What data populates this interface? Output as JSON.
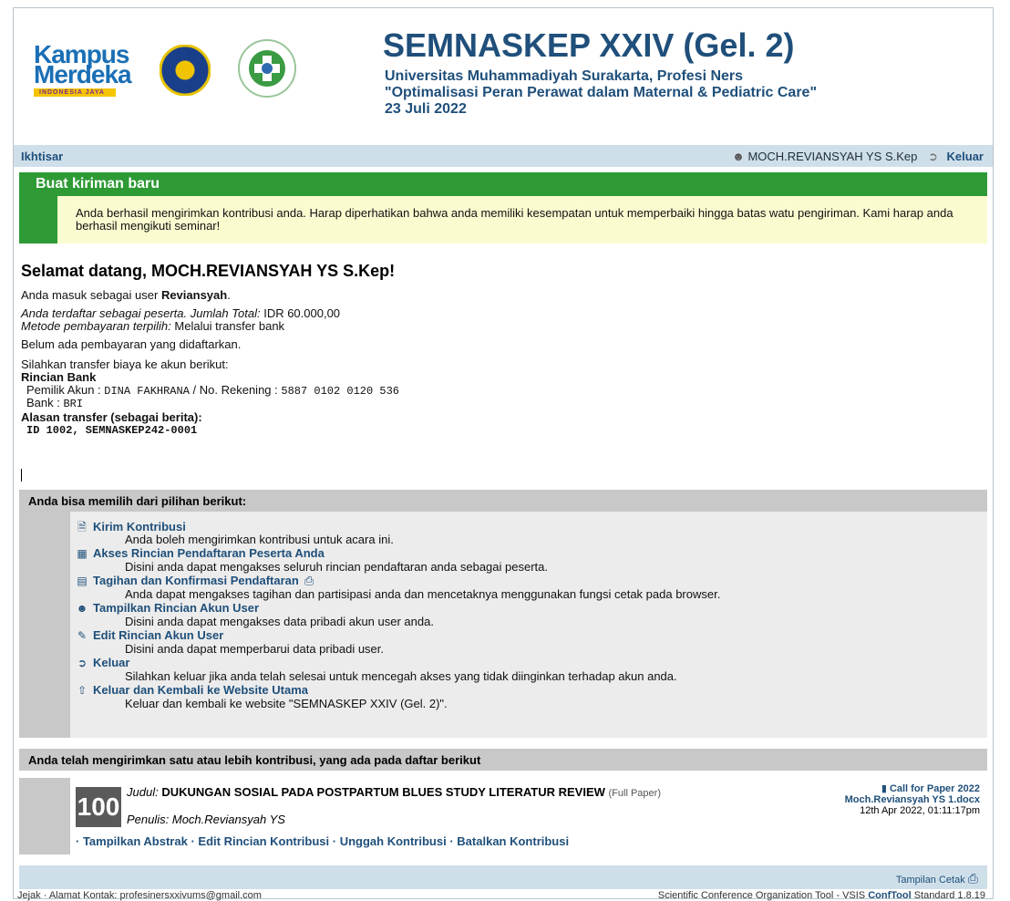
{
  "header": {
    "logo_kampus_line1": "Kampus",
    "logo_kampus_line2": "Merdeka",
    "logo_kampus_tagline": "INDONESIA JAYA",
    "title": "SEMNASKEP XXIV (Gel. 2)",
    "subtitle_line1": "Universitas Muhammadiyah Surakarta, Profesi Ners",
    "subtitle_line2": "\"Optimalisasi Peran Perawat dalam Maternal & Pediatric Care\"",
    "subtitle_line3": "23 Juli 2022"
  },
  "navbar": {
    "overview": "Ikhtisar",
    "user": "MOCH.REVIANSYAH YS S.Kep",
    "logout": "Keluar"
  },
  "banner": {
    "title": "Buat kiriman baru",
    "message": "Anda berhasil mengirimkan kontribusi anda. Harap diperhatikan bahwa anda memiliki kesempatan untuk memperbaiki hingga batas watu pengiriman. Kami harap anda berhasil mengikuti seminar!"
  },
  "welcome": {
    "heading": "Selamat datang, MOCH.REVIANSYAH YS S.Kep!",
    "login_prefix": "Anda masuk sebagai user ",
    "login_user": "Reviansyah",
    "login_suffix": ".",
    "registered_label": "Anda terdaftar sebagai peserta. Jumlah Total:",
    "registered_value": "IDR 60.000,00",
    "payment_method_label": "Metode pembayaran terpilih:",
    "payment_method_value": "Melalui transfer bank",
    "no_payment": "Belum ada pembayaran yang didaftarkan.",
    "transfer_instruction": "Silahkan transfer biaya ke akun berikut:",
    "bank_details_title": "Rincian Bank",
    "owner_label": "Pemilik Akun :",
    "owner_value": "DINA FAKHRANA",
    "account_label": "/ No. Rekening :",
    "account_value": "5887 0102 0120 536",
    "bank_label": "Bank :",
    "bank_value": "BRI",
    "reason_title": "Alasan transfer (sebagai berita):",
    "reason_value": "ID 1002, SEMNASKEP242-0001"
  },
  "options": {
    "heading": "Anda bisa memilih dari pilihan berikut:",
    "items": [
      {
        "label": "Kirim Kontribusi",
        "desc": "Anda boleh mengirimkan kontribusi untuk acara ini.",
        "icon": "document-icon"
      },
      {
        "label": "Akses Rincian Pendaftaran Peserta Anda",
        "desc": "Disini anda dapat mengakses seluruh rincian pendaftaran anda sebagai peserta.",
        "icon": "id-card-icon"
      },
      {
        "label": "Tagihan dan Konfirmasi Pendaftaran",
        "desc": "Anda dapat mengakses tagihan dan partisipasi anda dan mencetaknya menggunakan fungsi cetak pada browser.",
        "icon": "invoice-icon"
      },
      {
        "label": "Tampilkan Rincian Akun User",
        "desc": "Disini anda dapat mengakses data pribadi akun user anda.",
        "icon": "user-search-icon"
      },
      {
        "label": "Edit Rincian Akun User",
        "desc": "Disini anda dapat memperbarui data pribadi user.",
        "icon": "user-edit-icon"
      },
      {
        "label": "Keluar",
        "desc": "Silahkan keluar jika anda telah selesai untuk mencegah akses yang tidak diinginkan terhadap akun anda.",
        "icon": "logout-icon"
      },
      {
        "label": "Keluar dan Kembali ke Website Utama",
        "desc": "Keluar dan kembali ke website \"SEMNASKEP XXIV (Gel. 2)\".",
        "icon": "home-exit-icon"
      }
    ]
  },
  "submissions": {
    "heading": "Anda telah mengirimkan satu atau lebih kontribusi, yang ada pada daftar berikut",
    "items": [
      {
        "id": "100",
        "title_label": "Judul:",
        "title": "DUKUNGAN SOSIAL PADA POSTPARTUM BLUES STUDY LITERATUR REVIEW",
        "type": "(Full Paper)",
        "author_label": "Penulis:",
        "author": "Moch.Reviansyah YS",
        "track": "Call for Paper 2022",
        "file": "Moch.Reviansyah YS 1.docx",
        "date": "12th Apr 2022, 01:11:17pm",
        "actions": [
          "Tampilkan Abstrak",
          "Edit Rincian Kontribusi",
          "Unggah Kontribusi",
          "Batalkan Kontribusi"
        ]
      }
    ]
  },
  "footer": {
    "print_label": "Tampilan Cetak",
    "left": "Jejak · Alamat Kontak: profesinersxxivums@gmail.com",
    "right_prefix": "Scientific Conference Organization Tool - VSIS ",
    "right_brand": "ConfTool",
    "right_suffix": " Standard 1.8.19"
  }
}
